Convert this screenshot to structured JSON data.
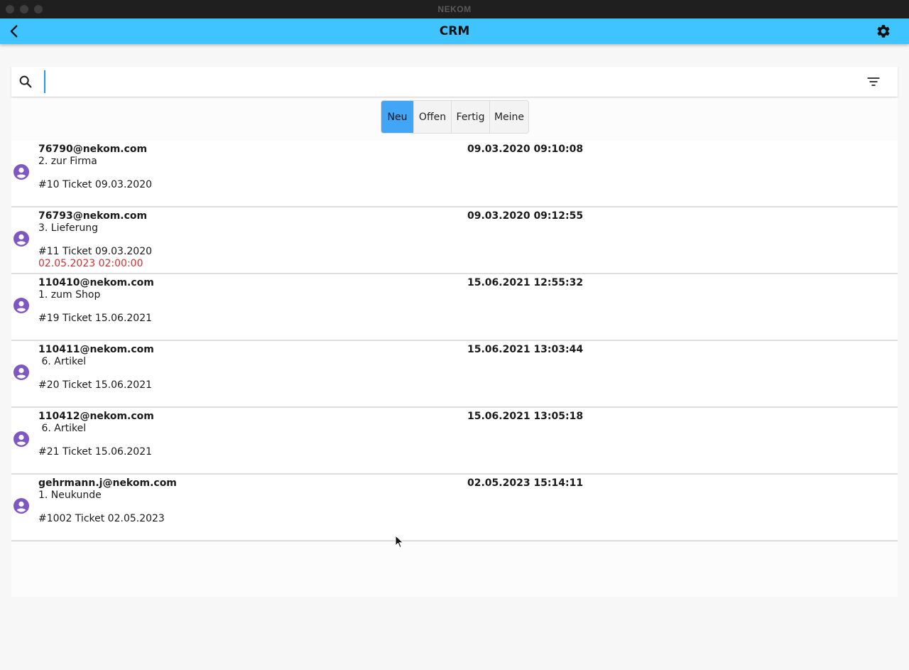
{
  "window": {
    "title": "NEKOM"
  },
  "appbar": {
    "title": "CRM",
    "back_icon": "chevron-left-icon",
    "settings_icon": "gear-icon"
  },
  "search": {
    "value": "",
    "placeholder": "",
    "search_icon": "search-icon",
    "filter_icon": "filter-icon"
  },
  "tabs": [
    {
      "label": "Neu",
      "active": true
    },
    {
      "label": "Offen",
      "active": false
    },
    {
      "label": "Fertig",
      "active": false
    },
    {
      "label": "Meine",
      "active": false
    }
  ],
  "tickets": [
    {
      "email": "76790@nekom.com",
      "date": "09.03.2020 09:10:08",
      "subject": "2. zur Firma",
      "ticket": "#10 Ticket 09.03.2020",
      "due": ""
    },
    {
      "email": "76793@nekom.com",
      "date": "09.03.2020 09:12:55",
      "subject": "3. Lieferung",
      "ticket": "#11 Ticket 09.03.2020",
      "due": "02.05.2023 02:00:00"
    },
    {
      "email": "110410@nekom.com",
      "date": "15.06.2021 12:55:32",
      "subject": "1. zum Shop",
      "ticket": "#19 Ticket 15.06.2021",
      "due": ""
    },
    {
      "email": "110411@nekom.com",
      "date": "15.06.2021 13:03:44",
      "subject": " 6. Artikel",
      "ticket": "#20 Ticket 15.06.2021",
      "due": ""
    },
    {
      "email": "110412@nekom.com",
      "date": "15.06.2021 13:05:18",
      "subject": " 6. Artikel",
      "ticket": "#21 Ticket 15.06.2021",
      "due": ""
    },
    {
      "email": "gehrmann.j@nekom.com",
      "date": "02.05.2023 15:14:11",
      "subject": "1. Neukunde",
      "ticket": "#1002 Ticket 02.05.2023",
      "due": ""
    }
  ],
  "colors": {
    "appbar": "#40c4ff",
    "tab_active": "#42a5f5",
    "avatar": "#7e57c2",
    "due": "#d32f2f"
  }
}
